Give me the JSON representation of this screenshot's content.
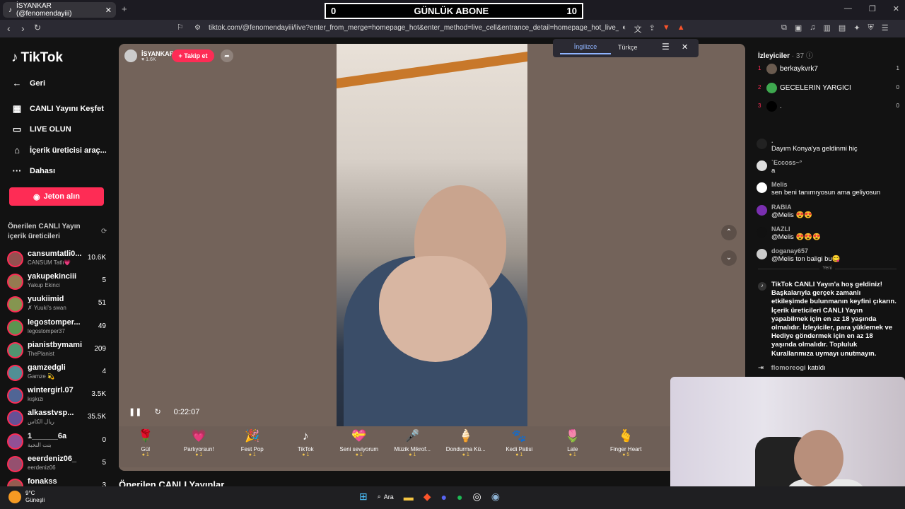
{
  "browser": {
    "tab_title": "İSYANKAR (@fenomendayiii)",
    "url": "tiktok.com/@fenomendayiii/live?enter_from_merge=homepage_hot&enter_method=live_cell&entrance_detail=homepage_hot_live_cell&fr..."
  },
  "scoreboard": {
    "left": "0",
    "title": "GÜNLÜK ABONE",
    "right": "10"
  },
  "translate": {
    "from": "İngilizce",
    "to": "Türkçe"
  },
  "sidebar": {
    "logo": "TikTok",
    "back": "Geri",
    "nav": [
      "CANLI Yayını Keşfet",
      "LIVE OLUN",
      "İçerik üreticisi araç...",
      "Dahası"
    ],
    "coins_button": "Jeton alın",
    "recommended_title": "Önerilen CANLI Yayın içerik üreticileri",
    "creators": [
      {
        "name": "cansumtatli0...",
        "sub": "CANSUM Tatlı💗",
        "count": "10.6K"
      },
      {
        "name": "yakupekinciii",
        "sub": "Yakup Ekinci",
        "count": "5"
      },
      {
        "name": "yuukiimid",
        "sub": "✗ Yuuki's swan",
        "count": "51"
      },
      {
        "name": "legostomper...",
        "sub": "legostomper37",
        "count": "49"
      },
      {
        "name": "pianistbymami",
        "sub": "ThePlanist",
        "count": "209"
      },
      {
        "name": "gamzedgli",
        "sub": "Gamze 💫",
        "count": "4"
      },
      {
        "name": "wintergirl.07",
        "sub": "kışkızı",
        "count": "3.5K"
      },
      {
        "name": "alkasstvsp...",
        "sub": "ريال الكاس",
        "count": "35.5K"
      },
      {
        "name": "1______6a",
        "sub": "بنت النخبة",
        "count": "0"
      },
      {
        "name": "eeerdeniz06_",
        "sub": "eerdeniz06",
        "count": "5"
      },
      {
        "name": "fonakss",
        "sub": "",
        "count": "3"
      }
    ]
  },
  "stream": {
    "host_name": "İSYANKAR",
    "host_likes": "♥ 1.6K",
    "follow_button": "+ Takip et",
    "time": "0:22:07"
  },
  "gifts": [
    {
      "name": "Gül",
      "price": "1",
      "icon": "🌹"
    },
    {
      "name": "Parlıyorsun!",
      "price": "1",
      "icon": "💗"
    },
    {
      "name": "Fest Pop",
      "price": "1",
      "icon": "🎉"
    },
    {
      "name": "TikTok",
      "price": "1",
      "icon": "♪"
    },
    {
      "name": "Seni seviyorum",
      "price": "1",
      "icon": "💝"
    },
    {
      "name": "Müzik Mikrof...",
      "price": "1",
      "icon": "🎤"
    },
    {
      "name": "Dondurma Kü...",
      "price": "1",
      "icon": "🍦"
    },
    {
      "name": "Kedi Patisi",
      "price": "1",
      "icon": "🐾"
    },
    {
      "name": "Lale",
      "price": "1",
      "icon": "🌷"
    },
    {
      "name": "Finger Heart",
      "price": "5",
      "icon": "🫰"
    }
  ],
  "recommended_live": "Önerilen CANLI Yayınlar",
  "panel": {
    "viewers_label": "İzleyiciler",
    "viewers_count": "· 37",
    "top_viewers": [
      {
        "rank": "1",
        "name": "berkaykvrk7",
        "score": "1"
      },
      {
        "rank": "2",
        "name": "GECELERIN YARGICI",
        "score": "0"
      },
      {
        "rank": "3",
        "name": ".",
        "score": "0"
      }
    ],
    "messages": [
      {
        "name": ".",
        "text": "Dayım Konya'ya geldinmi hiç"
      },
      {
        "name": "`Eccoss~°",
        "text": "a"
      },
      {
        "name": "Melis",
        "text": "sen beni tanımıyosun ama geliyosun"
      },
      {
        "name": "RABIA",
        "text": "@Melis 😍😍"
      },
      {
        "name": "NAZLI",
        "text": "@Melis 😍😍😍"
      },
      {
        "name": "doganay657",
        "text": "@Melis ton baligi bu😋"
      }
    ],
    "new_label": "Yeni",
    "welcome": "TikTok CANLI Yayın'a hoş geldiniz! Başkalarıyla gerçek zamanlı etkileşimde bulunmanın keyfini çıkarın. İçerik üreticileri CANLI Yayın yapabilmek için en az 18 yaşında olmalıdır. İzleyiciler, para yüklemek ve Hediye göndermek için en az 18 yaşında olmalıdır. Topluluk Kurallarımıza uymayı unutmayın.",
    "joined_name": "flomoreogi",
    "joined_text": "katıldı"
  },
  "taskbar": {
    "temp": "9°C",
    "weather": "Güneşli",
    "search": "Ara"
  },
  "colors": {
    "accent": "#fe2c55",
    "stream_bg": "#73635a"
  }
}
